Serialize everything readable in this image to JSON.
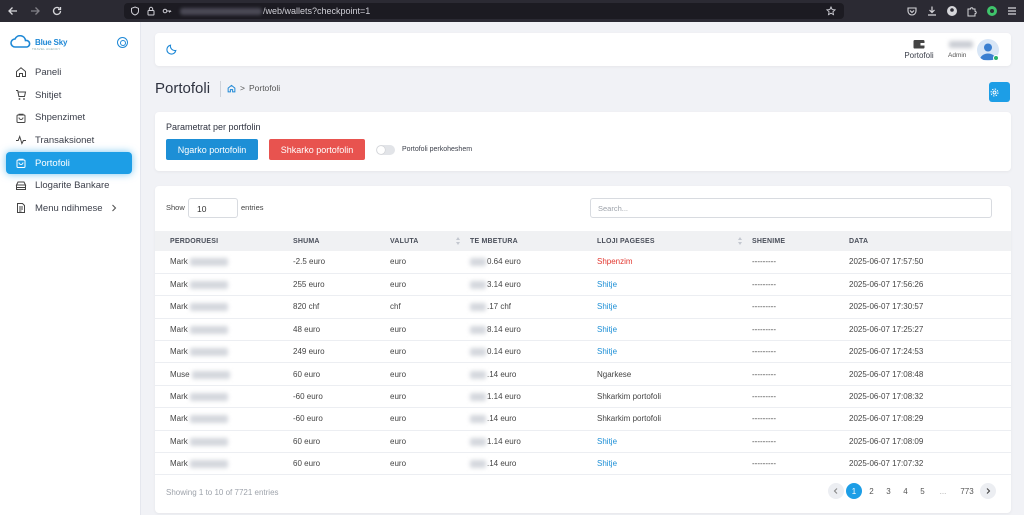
{
  "browser": {
    "url_path": "/web/wallets?checkpoint=1"
  },
  "sidebar": {
    "logo_text": "Blue Sky",
    "logo_sub": "TRAVEL AGENCY",
    "items": [
      {
        "label": "Paneli",
        "icon": "home-icon"
      },
      {
        "label": "Shitjet",
        "icon": "cart-icon"
      },
      {
        "label": "Shpenzimet",
        "icon": "bag-icon"
      },
      {
        "label": "Transaksionet",
        "icon": "activity-icon"
      },
      {
        "label": "Portofoli",
        "icon": "wallet-bag-icon",
        "active": true
      },
      {
        "label": "Llogarite Bankare",
        "icon": "bank-icon"
      },
      {
        "label": "Menu ndihmese",
        "icon": "document-icon"
      }
    ]
  },
  "header": {
    "wallet_label": "Portofoli",
    "user_role": "Admin"
  },
  "page": {
    "title": "Portofoli",
    "breadcrumb": "Portofoli"
  },
  "params": {
    "title": "Parametrat per portfolin",
    "load_button": "Ngarko portofolin",
    "unload_button": "Shkarko portofolin",
    "toggle_label": "Portofoli perkoheshem"
  },
  "table": {
    "show_label": "Show",
    "entries_label": "entries",
    "page_length": "10",
    "search_placeholder": "Search...",
    "columns": [
      "PERDORUESI",
      "SHUMA",
      "VALUTA",
      "TE MBETURA",
      "LLOJI PAGESES",
      "SHENIME",
      "DATA"
    ],
    "rows": [
      {
        "user": "Mark",
        "amount": "-2.5 euro",
        "currency": "euro",
        "remaining": "0.64 euro",
        "type": "Shpenzim",
        "type_style": "red",
        "note": "---------",
        "date": "2025-06-07 17:57:50"
      },
      {
        "user": "Mark",
        "amount": "255 euro",
        "currency": "euro",
        "remaining": "3.14 euro",
        "type": "Shitje",
        "type_style": "blue",
        "note": "---------",
        "date": "2025-06-07 17:56:26"
      },
      {
        "user": "Mark",
        "amount": "820 chf",
        "currency": "chf",
        "remaining": ".17 chf",
        "type": "Shitje",
        "type_style": "blue",
        "note": "---------",
        "date": "2025-06-07 17:30:57"
      },
      {
        "user": "Mark",
        "amount": "48 euro",
        "currency": "euro",
        "remaining": "8.14 euro",
        "type": "Shitje",
        "type_style": "blue",
        "note": "---------",
        "date": "2025-06-07 17:25:27"
      },
      {
        "user": "Mark",
        "amount": "249 euro",
        "currency": "euro",
        "remaining": "0.14 euro",
        "type": "Shitje",
        "type_style": "blue",
        "note": "---------",
        "date": "2025-06-07 17:24:53"
      },
      {
        "user": "Muse",
        "amount": "60 euro",
        "currency": "euro",
        "remaining": ".14 euro",
        "type": "Ngarkese",
        "type_style": "plain",
        "note": "---------",
        "date": "2025-06-07 17:08:48"
      },
      {
        "user": "Mark",
        "amount": "-60 euro",
        "currency": "euro",
        "remaining": "1.14 euro",
        "type": "Shkarkim portofoli",
        "type_style": "plain",
        "note": "---------",
        "date": "2025-06-07 17:08:32"
      },
      {
        "user": "Mark",
        "amount": "-60 euro",
        "currency": "euro",
        "remaining": ".14 euro",
        "type": "Shkarkim portofoli",
        "type_style": "plain",
        "note": "---------",
        "date": "2025-06-07 17:08:29"
      },
      {
        "user": "Mark",
        "amount": "60 euro",
        "currency": "euro",
        "remaining": "1.14 euro",
        "type": "Shitje",
        "type_style": "blue",
        "note": "---------",
        "date": "2025-06-07 17:08:09"
      },
      {
        "user": "Mark",
        "amount": "60 euro",
        "currency": "euro",
        "remaining": ".14 euro",
        "type": "Shitje",
        "type_style": "blue",
        "note": "---------",
        "date": "2025-06-07 17:07:32"
      }
    ],
    "info": "Showing 1 to 10 of 7721 entries",
    "pagination": [
      "1",
      "2",
      "3",
      "4",
      "5",
      "...",
      "773"
    ],
    "current_page": "1"
  },
  "colors": {
    "accent": "#1d9ee6",
    "danger": "#e8534f",
    "link_blue": "#1d8fd6",
    "link_red": "#e2372f"
  }
}
